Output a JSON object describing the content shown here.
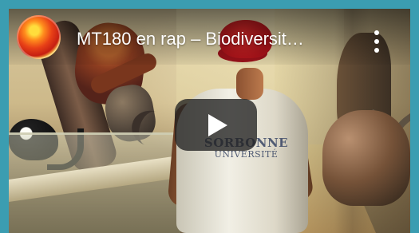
{
  "video": {
    "title": "MT180 en rap – Biodiversit…",
    "shirt_logo_line1": "SORBONNE",
    "shirt_logo_line2": "UNIVERSITÉ",
    "icons": {
      "channel": "channel-avatar-icon",
      "menu": "more-vertical-icon",
      "play": "play-icon"
    },
    "colors": {
      "border": "#3b9db1",
      "title": "#ffffff",
      "play_button": "#212121",
      "cap": "#c81e22"
    }
  }
}
